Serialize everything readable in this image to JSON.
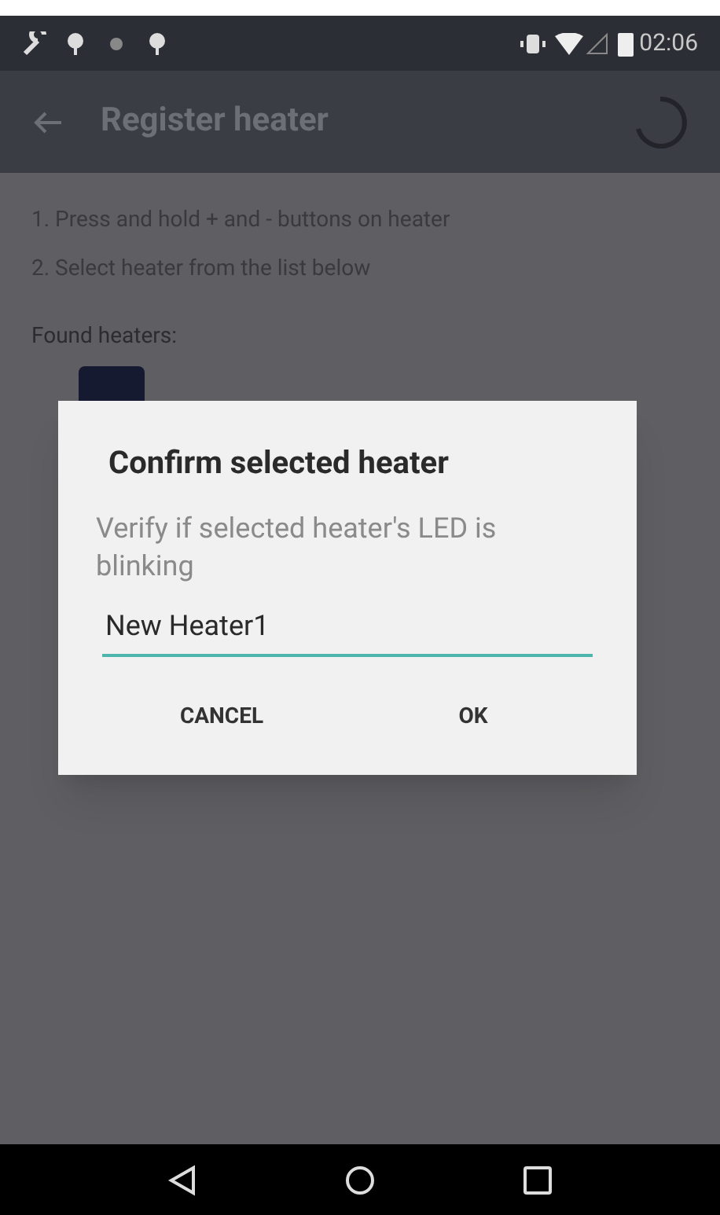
{
  "status_bar": {
    "time": "02:06"
  },
  "app_bar": {
    "title": "Register heater"
  },
  "instructions": [
    "1. Press and hold + and - buttons on heater",
    "2. Select heater from the list below"
  ],
  "found_label": "Found heaters:",
  "dialog": {
    "title": "Confirm selected heater",
    "message": "Verify if selected heater's LED is blinking",
    "field": {
      "value": "New Heater1"
    },
    "buttons": [
      "CANCEL",
      "OK"
    ]
  }
}
